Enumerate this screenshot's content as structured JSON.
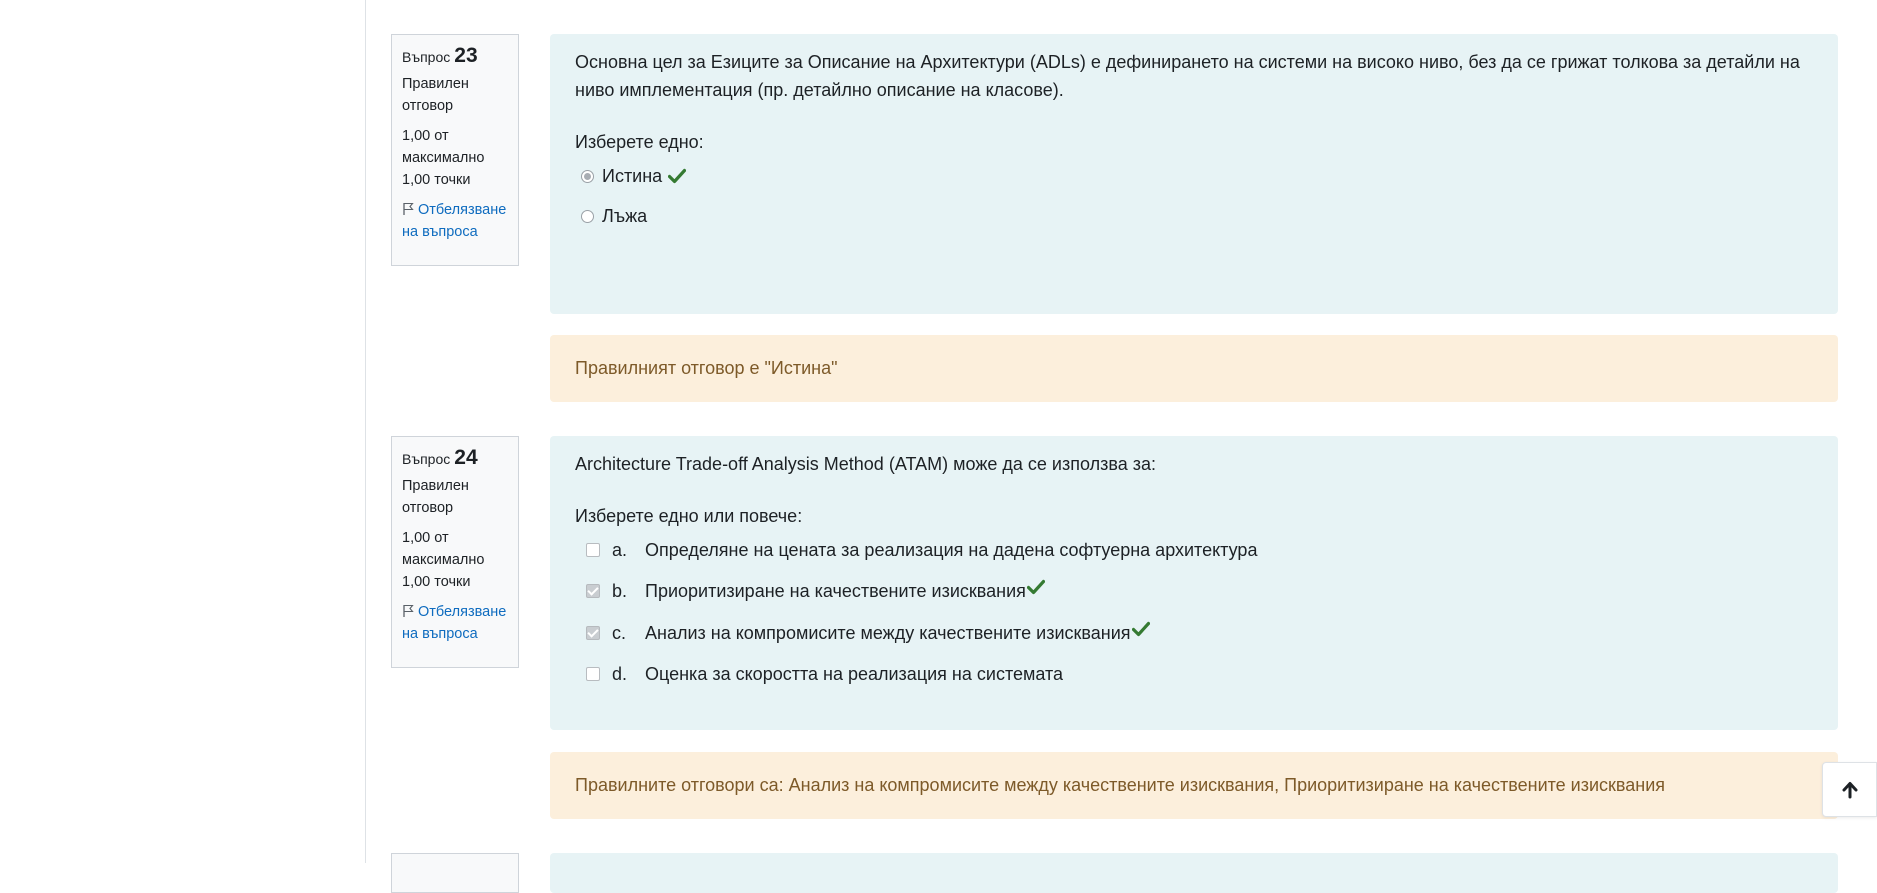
{
  "questions": [
    {
      "label": "Въпрос",
      "number": "23",
      "state": "Правилен отговор",
      "grade": "1,00 от максимално 1,00 точки",
      "flag": "Отбелязване на въпроса",
      "text": "Основна цел за Езиците за Описание на Архитектури (ADLs) е дефинирането на системи на високо ниво, без да се грижат толкова за детайли на ниво имплементация (пр. детайлно описание на класове).",
      "prompt": "Изберете едно:",
      "answers": [
        {
          "label": "Истина",
          "checked": true,
          "correct": true
        },
        {
          "label": "Лъжа",
          "checked": false,
          "correct": false
        }
      ],
      "feedback": "Правилният отговор е \"Истина\""
    },
    {
      "label": "Въпрос",
      "number": "24",
      "state": "Правилен отговор",
      "grade": "1,00 от максимално 1,00 точки",
      "flag": "Отбелязване на въпроса",
      "text": "Architecture Trade-off Analysis Method (ATAM) може да се използва за:",
      "prompt": "Изберете едно или повече:",
      "answers": [
        {
          "letter": "a.",
          "label": "Определяне на цената за реализация на дадена софтуерна архитектура",
          "checked": false,
          "correct": false
        },
        {
          "letter": "b.",
          "label": "Приоритизиране на качествените изисквания",
          "checked": true,
          "correct": true
        },
        {
          "letter": "c.",
          "label": "Анализ на компромисите между качествените изисквания",
          "checked": true,
          "correct": true
        },
        {
          "letter": "d.",
          "label": "Оценка за скоростта на реализация на системата",
          "checked": false,
          "correct": false
        }
      ],
      "feedback": "Правилните отговори са: Анализ на компромисите между качествените изисквания, Приоритизиране на качествените изисквания"
    }
  ],
  "colors": {
    "correct_tick": "#357a32",
    "flag_link": "#0f6cbf",
    "formulation_bg": "#e7f3f5",
    "feedback_bg": "#fcefdc",
    "feedback_text": "#7d5a29"
  },
  "icons": {
    "flag": "flag-icon",
    "tick": "check-icon",
    "back_to_top": "arrow-up-icon"
  }
}
